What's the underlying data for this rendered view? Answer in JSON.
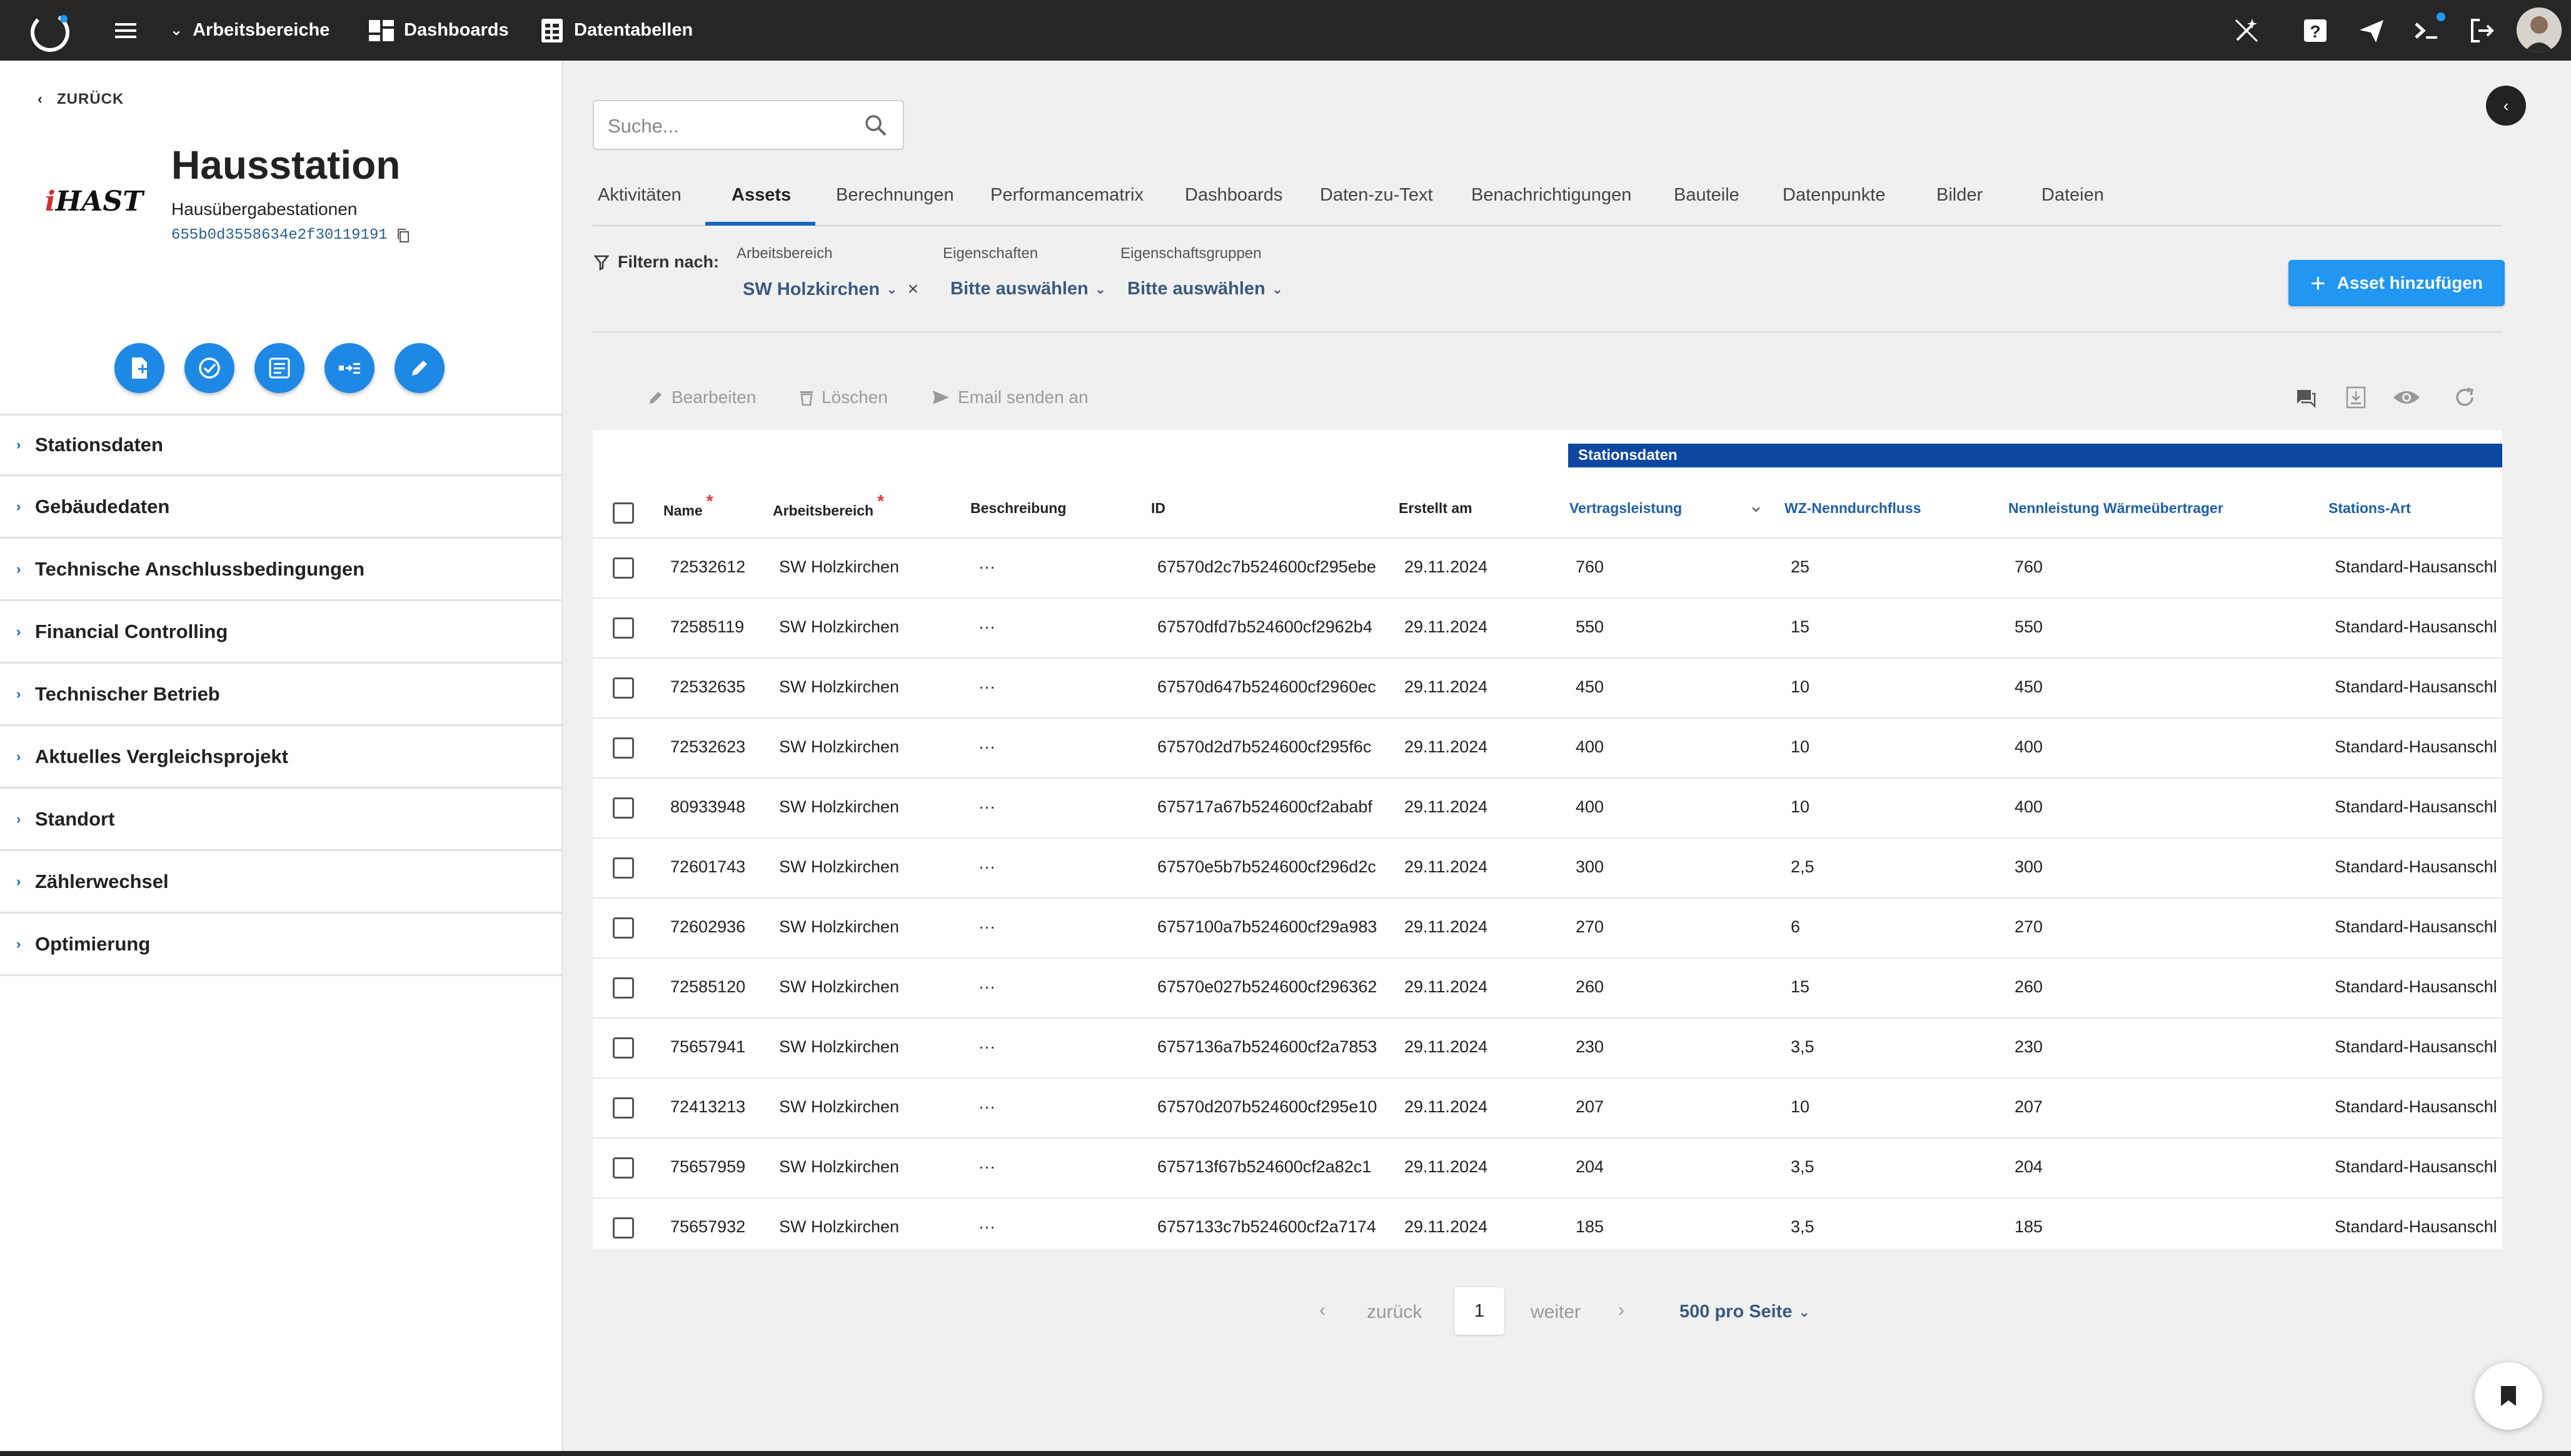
{
  "topbar": {
    "workspaces_label": "Arbeitsbereiche",
    "dashboards_label": "Dashboards",
    "datatables_label": "Datentabellen"
  },
  "sidebar": {
    "back_label": "ZURÜCK",
    "logo_i": "i",
    "logo_rest": "HAST",
    "title": "Hausstation",
    "subtitle": "Hausübergabestationen",
    "station_id": "655b0d3558634e2f30119191",
    "sections": [
      "Stationsdaten",
      "Gebäudedaten",
      "Technische Anschlussbedingungen",
      "Financial Controlling",
      "Technischer Betrieb",
      "Aktuelles Vergleichsprojekt",
      "Standort",
      "Zählerwechsel",
      "Optimierung"
    ]
  },
  "search": {
    "placeholder": "Suche..."
  },
  "tabs": [
    "Aktivitäten",
    "Assets",
    "Berechnungen",
    "Performancematrix",
    "Dashboards",
    "Daten-zu-Text",
    "Benachrichtigungen",
    "Bauteile",
    "Datenpunkte",
    "Bilder",
    "Dateien"
  ],
  "active_tab": "Assets",
  "filter": {
    "label": "Filtern nach:",
    "workspace": {
      "label": "Arbeitsbereich",
      "value": "SW Holzkirchen"
    },
    "properties": {
      "label": "Eigenschaften",
      "value": "Bitte auswählen"
    },
    "property_groups": {
      "label": "Eigenschaftsgruppen",
      "value": "Bitte auswählen"
    }
  },
  "add_asset_label": "Asset hinzufügen",
  "toolbar": {
    "edit_label": "Bearbeiten",
    "delete_label": "Löschen",
    "email_label": "Email senden an"
  },
  "table": {
    "group_header": "Stationsdaten",
    "columns": {
      "name": "Name",
      "workspace": "Arbeitsbereich",
      "description": "Beschreibung",
      "id": "ID",
      "created": "Erstellt am",
      "contract_power": "Vertragsleistung",
      "wz_flow": "WZ-Nenndurchfluss",
      "hx_power": "Nennleistung Wärmeübertrager",
      "station_type": "Stations-Art"
    },
    "rows": [
      {
        "name": "72532612",
        "workspace": "SW Holzkirchen",
        "desc": "···",
        "id": "67570d2c7b524600cf295ebe",
        "created": "29.11.2024",
        "power": "760",
        "flow": "25",
        "hx": "760",
        "type": "Standard-Hausanschl"
      },
      {
        "name": "72585119",
        "workspace": "SW Holzkirchen",
        "desc": "···",
        "id": "67570dfd7b524600cf2962b4",
        "created": "29.11.2024",
        "power": "550",
        "flow": "15",
        "hx": "550",
        "type": "Standard-Hausanschl"
      },
      {
        "name": "72532635",
        "workspace": "SW Holzkirchen",
        "desc": "···",
        "id": "67570d647b524600cf2960ec",
        "created": "29.11.2024",
        "power": "450",
        "flow": "10",
        "hx": "450",
        "type": "Standard-Hausanschl"
      },
      {
        "name": "72532623",
        "workspace": "SW Holzkirchen",
        "desc": "···",
        "id": "67570d2d7b524600cf295f6c",
        "created": "29.11.2024",
        "power": "400",
        "flow": "10",
        "hx": "400",
        "type": "Standard-Hausanschl"
      },
      {
        "name": "80933948",
        "workspace": "SW Holzkirchen",
        "desc": "···",
        "id": "675717a67b524600cf2ababf",
        "created": "29.11.2024",
        "power": "400",
        "flow": "10",
        "hx": "400",
        "type": "Standard-Hausanschl"
      },
      {
        "name": "72601743",
        "workspace": "SW Holzkirchen",
        "desc": "···",
        "id": "67570e5b7b524600cf296d2c",
        "created": "29.11.2024",
        "power": "300",
        "flow": "2,5",
        "hx": "300",
        "type": "Standard-Hausanschl"
      },
      {
        "name": "72602936",
        "workspace": "SW Holzkirchen",
        "desc": "···",
        "id": "6757100a7b524600cf29a983",
        "created": "29.11.2024",
        "power": "270",
        "flow": "6",
        "hx": "270",
        "type": "Standard-Hausanschl"
      },
      {
        "name": "72585120",
        "workspace": "SW Holzkirchen",
        "desc": "···",
        "id": "67570e027b524600cf296362",
        "created": "29.11.2024",
        "power": "260",
        "flow": "15",
        "hx": "260",
        "type": "Standard-Hausanschl"
      },
      {
        "name": "75657941",
        "workspace": "SW Holzkirchen",
        "desc": "···",
        "id": "6757136a7b524600cf2a7853",
        "created": "29.11.2024",
        "power": "230",
        "flow": "3,5",
        "hx": "230",
        "type": "Standard-Hausanschl"
      },
      {
        "name": "72413213",
        "workspace": "SW Holzkirchen",
        "desc": "···",
        "id": "67570d207b524600cf295e10",
        "created": "29.11.2024",
        "power": "207",
        "flow": "10",
        "hx": "207",
        "type": "Standard-Hausanschl"
      },
      {
        "name": "75657959",
        "workspace": "SW Holzkirchen",
        "desc": "···",
        "id": "675713f67b524600cf2a82c1",
        "created": "29.11.2024",
        "power": "204",
        "flow": "3,5",
        "hx": "204",
        "type": "Standard-Hausanschl"
      },
      {
        "name": "75657932",
        "workspace": "SW Holzkirchen",
        "desc": "···",
        "id": "6757133c7b524600cf2a7174",
        "created": "29.11.2024",
        "power": "185",
        "flow": "3,5",
        "hx": "185",
        "type": "Standard-Hausanschl"
      }
    ]
  },
  "pagination": {
    "prev_label": "zurück",
    "page": "1",
    "next_label": "weiter",
    "per_page": "500 pro Seite"
  },
  "colors": {
    "topbar": "#262626",
    "accent": "#1e88e5",
    "header_blue": "#0d47a1",
    "link_blue": "#3a5a80"
  }
}
